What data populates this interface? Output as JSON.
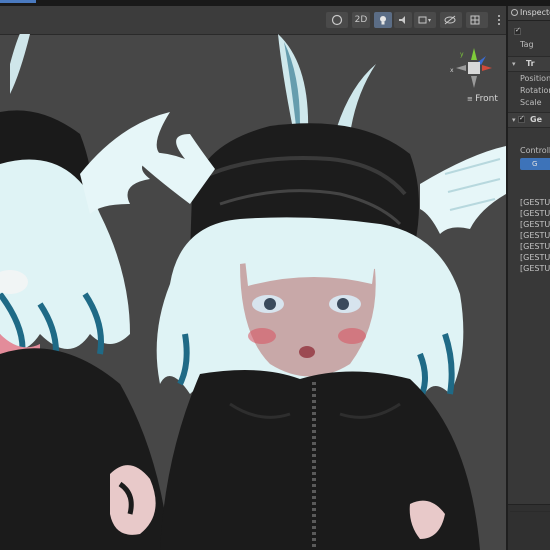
{
  "scene_toolbar": {
    "mode_2d_label": "2D"
  },
  "gizmo": {
    "view_label": "Front"
  },
  "inspector": {
    "tab_label": "Inspecto",
    "tag_label": "Tag",
    "transform_header": "Tr",
    "position_label": "Position",
    "rotation_label": "Rotation",
    "scale_label": "Scale",
    "component_header": "Ge",
    "controlling_label": "Controllin",
    "blue_button_label": "G",
    "gesture_items": [
      "[GESTUR",
      "[GESTUR",
      "[GESTUR",
      "[GESTUR",
      "[GESTUR",
      "[GESTUR",
      "[GESTUR"
    ]
  },
  "colors": {
    "scene_bg": "#474747",
    "inspector_bg": "#383838",
    "accent_blue": "#3d73b9",
    "hair": "#dff3f5",
    "hair_tip": "#1f6a86",
    "hoodie": "#1b1b1b"
  }
}
